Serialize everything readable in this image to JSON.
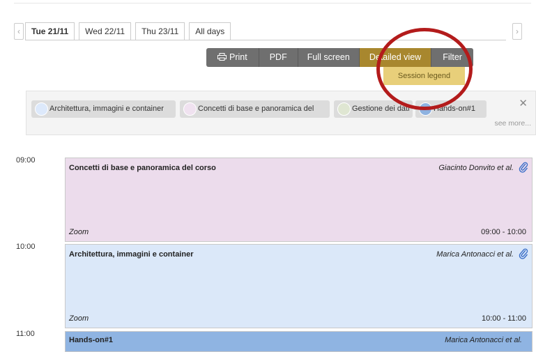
{
  "nav": {
    "prev": "‹",
    "next": "›"
  },
  "tabs": [
    {
      "label": "Tue 21/11",
      "active": true
    },
    {
      "label": "Wed 22/11"
    },
    {
      "label": "Thu 23/11"
    },
    {
      "label": "All days"
    }
  ],
  "toolbar": {
    "print": "Print",
    "pdf": "PDF",
    "fullscreen": "Full screen",
    "detailed": "Detailed view",
    "filter": "Filter",
    "dropdown": "Session legend"
  },
  "legend": {
    "chips": [
      {
        "label": "Architettura, immagini e container",
        "color": "#dde9fb"
      },
      {
        "label": "Concetti di base e panoramica del",
        "color": "#f0e2f0"
      },
      {
        "label": "Gestione dei dati",
        "color": "#dfe6d2"
      },
      {
        "label": "Hands-on#1",
        "color": "#8eb2e0"
      }
    ],
    "close": "✕",
    "see_more": "see more..."
  },
  "timetable": {
    "times": [
      "09:00",
      "10:00",
      "11:00"
    ],
    "blocks": [
      {
        "title": "Concetti di base e panoramica del corso",
        "speaker": "Giacinto Donvito et al.",
        "room": "Zoom",
        "range": "09:00 - 10:00",
        "color": "#ecdcec"
      },
      {
        "title": "Architettura, immagini e container",
        "speaker": "Marica Antonacci et al.",
        "room": "Zoom",
        "range": "10:00 - 11:00",
        "color": "#dbe8f9"
      },
      {
        "title": "Hands-on#1",
        "speaker": "Marica Antonacci et al.",
        "color": "#8fb4e2"
      }
    ]
  }
}
